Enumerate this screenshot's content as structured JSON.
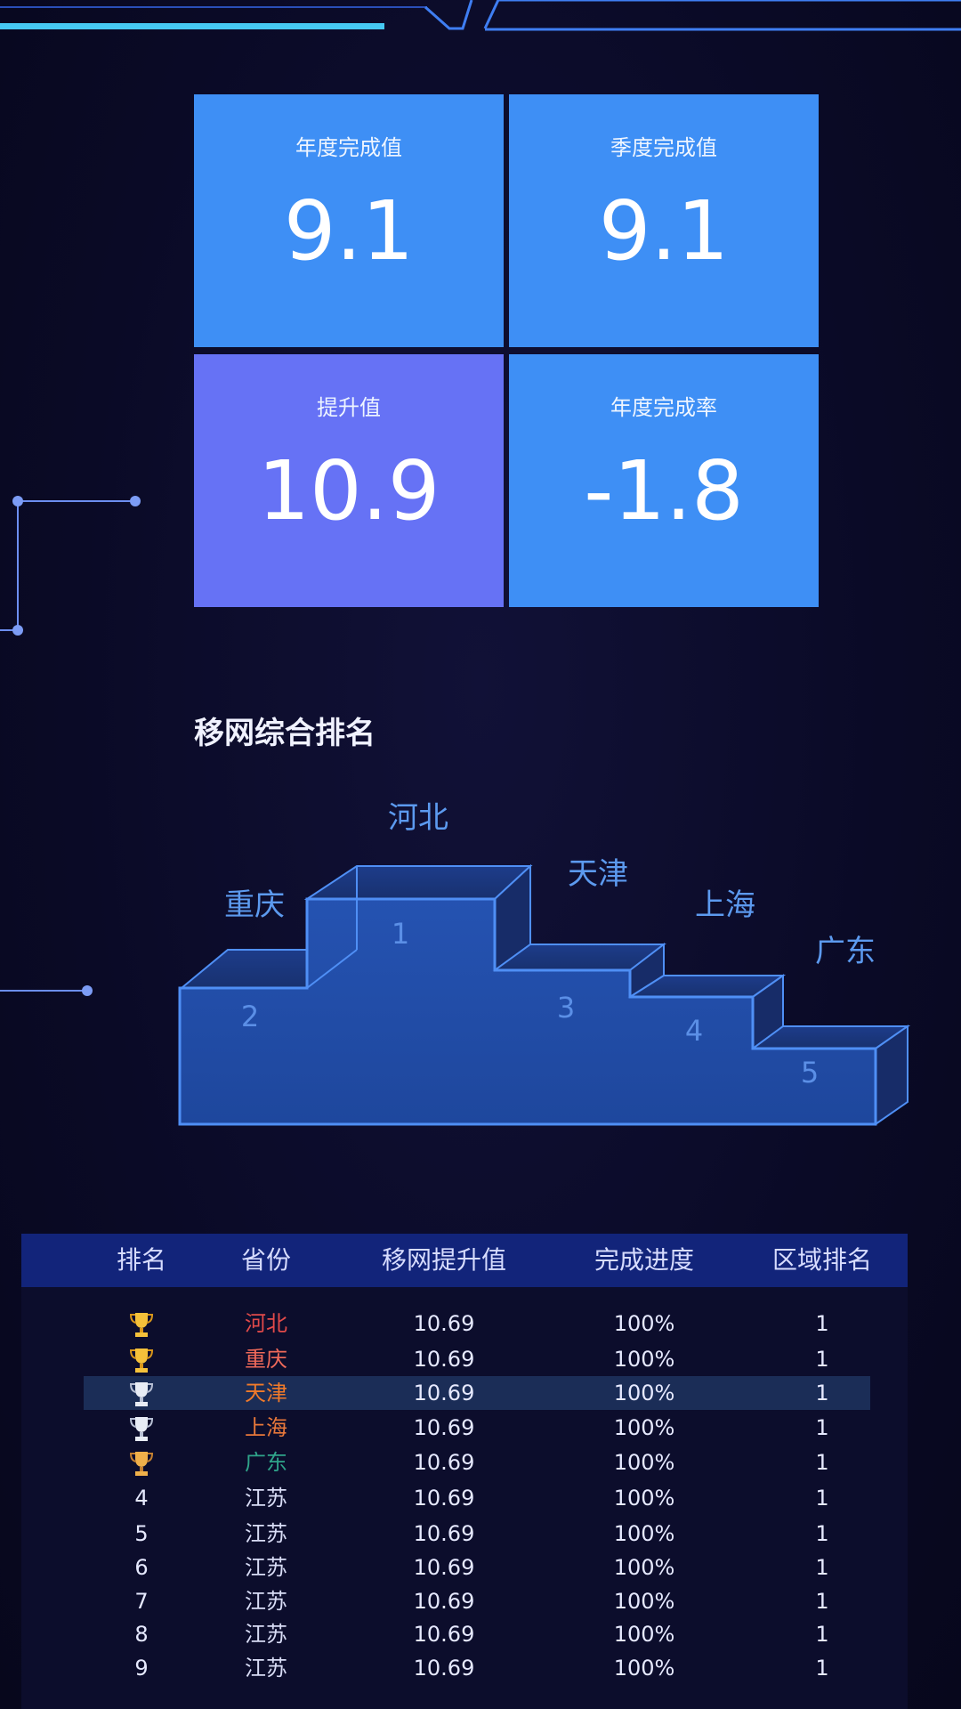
{
  "cards": [
    {
      "label": "年度完成值",
      "value": "9.1",
      "color": "#3e8ff5"
    },
    {
      "label": "季度完成值",
      "value": "9.1",
      "color": "#3e8ff5"
    },
    {
      "label": "提升值",
      "value": "10.9",
      "color": "#6672f5"
    },
    {
      "label": "年度完成率",
      "value": "-1.8",
      "color": "#3e8ff5"
    }
  ],
  "ranking": {
    "title": "移网综合排名",
    "podium": [
      {
        "place": "1",
        "name": "河北"
      },
      {
        "place": "2",
        "name": "重庆"
      },
      {
        "place": "3",
        "name": "天津"
      },
      {
        "place": "4",
        "name": "上海"
      },
      {
        "place": "5",
        "name": "广东"
      }
    ]
  },
  "table": {
    "headers": [
      "排名",
      "省份",
      "移网提升值",
      "完成进度",
      "区域排名"
    ],
    "rows": [
      {
        "rank": "",
        "trophy": "gold-trophy-icon",
        "province": "河北",
        "province_color": "#e24a4a",
        "value": "10.69",
        "progress": "100%",
        "area_rank": "1"
      },
      {
        "rank": "",
        "trophy": "gold-trophy-icon",
        "province": "重庆",
        "province_color": "#f06a5a",
        "value": "10.69",
        "progress": "100%",
        "area_rank": "1"
      },
      {
        "rank": "",
        "trophy": "silver-trophy-icon",
        "province": "天津",
        "province_color": "#f07a2a",
        "value": "10.69",
        "progress": "100%",
        "area_rank": "1"
      },
      {
        "rank": "",
        "trophy": "silver-trophy-icon",
        "province": "上海",
        "province_color": "#e8783a",
        "value": "10.69",
        "progress": "100%",
        "area_rank": "1"
      },
      {
        "rank": "",
        "trophy": "bronze-trophy-icon",
        "province": "广东",
        "province_color": "#2fa48a",
        "value": "10.69",
        "progress": "100%",
        "area_rank": "1"
      },
      {
        "rank": "4",
        "trophy": "",
        "province": "江苏",
        "province_color": "#d8dcf5",
        "value": "10.69",
        "progress": "100%",
        "area_rank": "1"
      },
      {
        "rank": "5",
        "trophy": "",
        "province": "江苏",
        "province_color": "#d8dcf5",
        "value": "10.69",
        "progress": "100%",
        "area_rank": "1"
      },
      {
        "rank": "6",
        "trophy": "",
        "province": "江苏",
        "province_color": "#d8dcf5",
        "value": "10.69",
        "progress": "100%",
        "area_rank": "1"
      },
      {
        "rank": "7",
        "trophy": "",
        "province": "江苏",
        "province_color": "#d8dcf5",
        "value": "10.69",
        "progress": "100%",
        "area_rank": "1"
      },
      {
        "rank": "8",
        "trophy": "",
        "province": "江苏",
        "province_color": "#d8dcf5",
        "value": "10.69",
        "progress": "100%",
        "area_rank": "1"
      },
      {
        "rank": "9",
        "trophy": "",
        "province": "江苏",
        "province_color": "#d8dcf5",
        "value": "10.69",
        "progress": "100%",
        "area_rank": "1"
      }
    ],
    "highlighted_row": 2
  }
}
